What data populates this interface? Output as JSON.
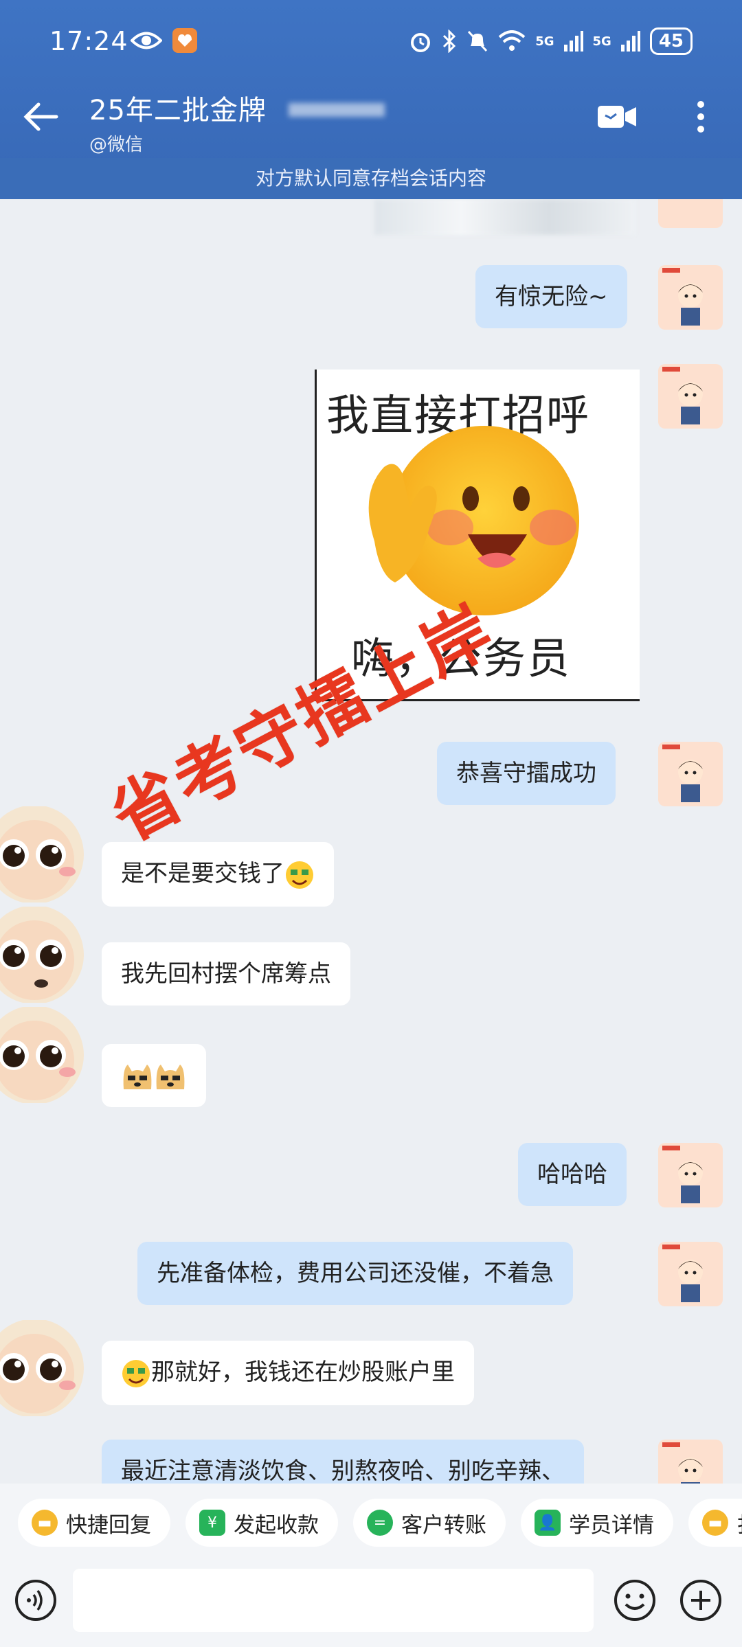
{
  "status_bar": {
    "time": "17:24",
    "network_1": "5G",
    "network_2": "5G",
    "battery": "45"
  },
  "header": {
    "title": "25年二批金牌",
    "subtitle": "@微信",
    "archive_notice": "对方默认同意存档会话内容"
  },
  "sticker": {
    "top_text": "我直接打招呼",
    "bottom_text": "嗨，公务员"
  },
  "overlay_text": "省考守擂上岸",
  "messages": [
    {
      "direction": "out",
      "text": "有惊无险~"
    },
    {
      "direction": "out",
      "text": "恭喜守擂成功"
    },
    {
      "direction": "in",
      "text": "是不是要交钱了"
    },
    {
      "direction": "in",
      "text": "我先回村摆个席筹点"
    },
    {
      "direction": "in",
      "text": ""
    },
    {
      "direction": "out",
      "text": "哈哈哈"
    },
    {
      "direction": "out",
      "text": "先准备体检，费用公司还没催，不着急"
    },
    {
      "direction": "in",
      "text": "那就好，我钱还在炒股账户里"
    },
    {
      "direction": "out",
      "text": "最近注意清淡饮食、别熬夜哈、别吃辛辣、"
    }
  ],
  "quick_actions": [
    {
      "label": "快捷回复",
      "icon": "quick-reply-icon",
      "color": "#f5b82e"
    },
    {
      "label": "发起收款",
      "icon": "payment-icon",
      "color": "#27b35a"
    },
    {
      "label": "客户转账",
      "icon": "transfer-icon",
      "color": "#27b35a"
    },
    {
      "label": "学员详情",
      "icon": "student-icon",
      "color": "#27b35a"
    },
    {
      "label": "扌",
      "icon": "quick-reply-icon",
      "color": "#f5b82e"
    }
  ],
  "input": {
    "placeholder": ""
  },
  "colors": {
    "header_bg": "#3b6fbd",
    "outgoing_bubble": "#cfe4fb",
    "incoming_bubble": "#ffffff",
    "overlay_red": "#e8371f"
  }
}
